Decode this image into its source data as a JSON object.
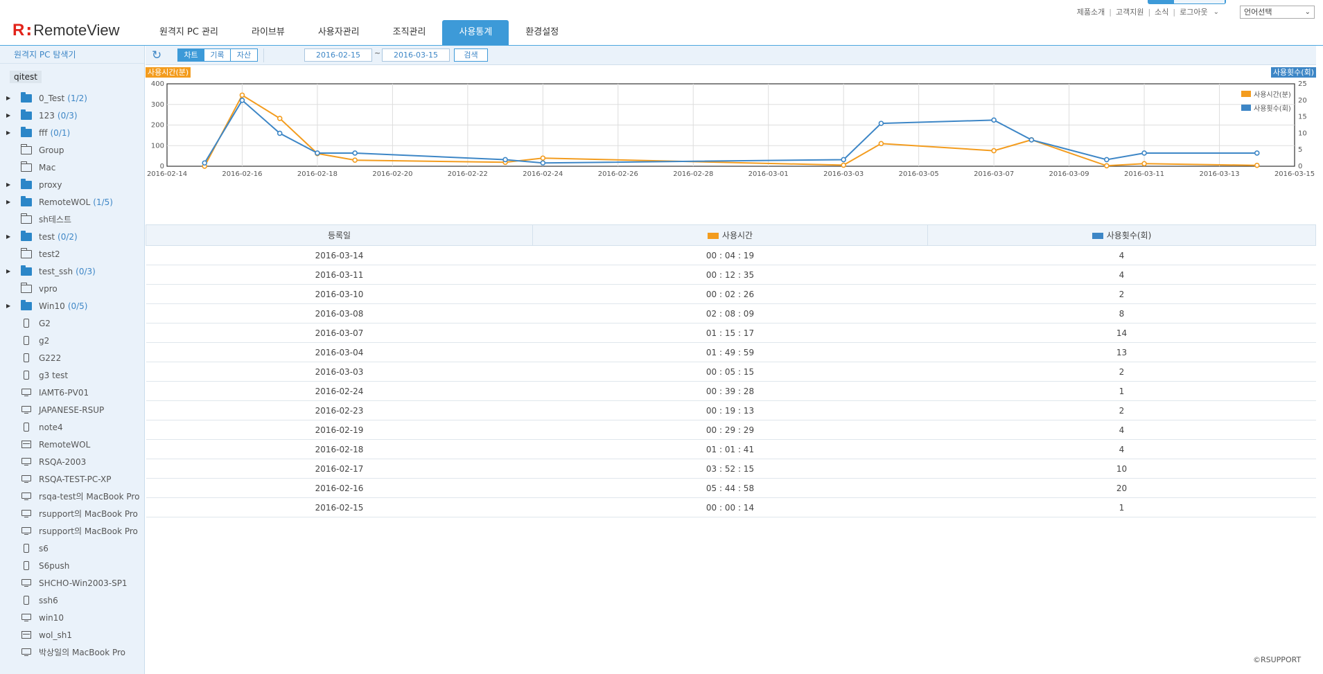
{
  "brand": {
    "logo_mark": "R",
    "name": "RemoteView"
  },
  "nav": {
    "tabs": [
      {
        "label": "원격지 PC 관리",
        "active": false
      },
      {
        "label": "라이브뷰",
        "active": false
      },
      {
        "label": "사용자관리",
        "active": false
      },
      {
        "label": "조직관리",
        "active": false
      },
      {
        "label": "사용통계",
        "active": true
      },
      {
        "label": "환경설정",
        "active": false
      }
    ]
  },
  "util": {
    "links": [
      "제품소개",
      "고객지원",
      "소식",
      "로그아웃"
    ],
    "language_select": "언어선택"
  },
  "sidebar": {
    "title": "원격지 PC 탐색기",
    "root": "qitest",
    "items": [
      {
        "label": "0_Test",
        "count": "(1/2)",
        "icon": "folder-filled-icon",
        "expandable": true
      },
      {
        "label": "123",
        "count": "(0/3)",
        "icon": "folder-filled-icon",
        "expandable": true
      },
      {
        "label": "fff",
        "count": "(0/1)",
        "icon": "folder-filled-icon",
        "expandable": true
      },
      {
        "label": "Group",
        "count": "",
        "icon": "folder-icon",
        "expandable": false
      },
      {
        "label": "Mac",
        "count": "",
        "icon": "folder-icon",
        "expandable": false
      },
      {
        "label": "proxy",
        "count": "",
        "icon": "folder-filled-icon",
        "expandable": true
      },
      {
        "label": "RemoteWOL",
        "count": "(1/5)",
        "icon": "folder-filled-icon",
        "expandable": true
      },
      {
        "label": "sh테스트",
        "count": "",
        "icon": "folder-icon",
        "expandable": false
      },
      {
        "label": "test",
        "count": "(0/2)",
        "icon": "folder-filled-icon",
        "expandable": true
      },
      {
        "label": "test2",
        "count": "",
        "icon": "folder-icon",
        "expandable": false
      },
      {
        "label": "test_ssh",
        "count": "(0/3)",
        "icon": "folder-filled-icon",
        "expandable": true
      },
      {
        "label": "vpro",
        "count": "",
        "icon": "folder-icon",
        "expandable": false
      },
      {
        "label": "Win10",
        "count": "(0/5)",
        "icon": "folder-filled-icon",
        "expandable": true
      },
      {
        "label": "G2",
        "count": "",
        "icon": "mobile-icon",
        "expandable": false
      },
      {
        "label": "g2",
        "count": "",
        "icon": "mobile-icon",
        "expandable": false
      },
      {
        "label": "G222",
        "count": "",
        "icon": "mobile-icon",
        "expandable": false
      },
      {
        "label": "g3 test",
        "count": "",
        "icon": "mobile-icon",
        "expandable": false
      },
      {
        "label": "IAMT6-PV01",
        "count": "",
        "icon": "monitor-icon",
        "expandable": false
      },
      {
        "label": "JAPANESE-RSUP",
        "count": "",
        "icon": "monitor-icon",
        "expandable": false
      },
      {
        "label": "note4",
        "count": "",
        "icon": "mobile-icon",
        "expandable": false
      },
      {
        "label": "RemoteWOL",
        "count": "",
        "icon": "server-icon",
        "expandable": false
      },
      {
        "label": "RSQA-2003",
        "count": "",
        "icon": "monitor-icon",
        "expandable": false
      },
      {
        "label": "RSQA-TEST-PC-XP",
        "count": "",
        "icon": "monitor-icon",
        "expandable": false
      },
      {
        "label": "rsqa-test의 MacBook Pro",
        "count": "",
        "icon": "monitor-icon",
        "expandable": false
      },
      {
        "label": "rsupport의 MacBook Pro",
        "count": "",
        "icon": "monitor-icon",
        "expandable": false
      },
      {
        "label": "rsupport의 MacBook Pro",
        "count": "",
        "icon": "monitor-icon",
        "expandable": false
      },
      {
        "label": "s6",
        "count": "",
        "icon": "mobile-icon",
        "expandable": false
      },
      {
        "label": "S6push",
        "count": "",
        "icon": "mobile-icon",
        "expandable": false
      },
      {
        "label": "SHCHO-Win2003-SP1",
        "count": "",
        "icon": "monitor-icon",
        "expandable": false
      },
      {
        "label": "ssh6",
        "count": "",
        "icon": "mobile-icon",
        "expandable": false
      },
      {
        "label": "win10",
        "count": "",
        "icon": "monitor-icon",
        "expandable": false
      },
      {
        "label": "wol_sh1",
        "count": "",
        "icon": "server-icon",
        "expandable": false
      },
      {
        "label": "박상일의 MacBook Pro",
        "count": "",
        "icon": "monitor-icon",
        "expandable": false
      }
    ]
  },
  "toolbar": {
    "refresh_icon": "refresh-icon",
    "views": [
      {
        "label": "차트",
        "active": true
      },
      {
        "label": "기록",
        "active": false
      },
      {
        "label": "자산",
        "active": false
      }
    ],
    "date_from": "2016-02-15",
    "tilde": "~",
    "date_to": "2016-03-15",
    "search_label": "검색"
  },
  "chart_data": {
    "type": "line",
    "left_axis_label": "사용시간(분)",
    "right_axis_label": "사용횟수(회)",
    "x_ticks": [
      "2016-02-14",
      "2016-02-16",
      "2016-02-18",
      "2016-02-20",
      "2016-02-22",
      "2016-02-24",
      "2016-02-26",
      "2016-02-28",
      "2016-03-01",
      "2016-03-03",
      "2016-03-05",
      "2016-03-07",
      "2016-03-09",
      "2016-03-11",
      "2016-03-13",
      "2016-03-15"
    ],
    "x": [
      "2016-02-15",
      "2016-02-16",
      "2016-02-17",
      "2016-02-18",
      "2016-02-19",
      "2016-02-23",
      "2016-02-24",
      "2016-03-03",
      "2016-03-04",
      "2016-03-07",
      "2016-03-08",
      "2016-03-10",
      "2016-03-11",
      "2016-03-14"
    ],
    "y_left_ticks": [
      0,
      100,
      200,
      300,
      400
    ],
    "y_left_range": [
      0,
      400
    ],
    "y_right_ticks": [
      0,
      5,
      10,
      15,
      20,
      25
    ],
    "y_right_range": [
      0,
      25
    ],
    "series": [
      {
        "name": "사용시간(분)",
        "axis": "left",
        "color": "#f39c1e",
        "values": [
          0.2,
          345,
          232.3,
          61.7,
          29.5,
          19.2,
          39.5,
          5.3,
          110,
          75.3,
          128.2,
          2.4,
          12.6,
          4.3
        ]
      },
      {
        "name": "사용횟수(회)",
        "axis": "right",
        "color": "#3d86c6",
        "values": [
          1,
          20,
          10,
          4,
          4,
          2,
          1,
          2,
          13,
          14,
          8,
          2,
          4,
          4
        ]
      }
    ],
    "legend_position": "top-right",
    "grid": true
  },
  "table": {
    "headers": {
      "date": "등록일",
      "time": "사용시간",
      "count": "사용횟수(회)"
    },
    "rows": [
      {
        "date": "2016-03-14",
        "time": "00 : 04 : 19",
        "count": "4"
      },
      {
        "date": "2016-03-11",
        "time": "00 : 12 : 35",
        "count": "4"
      },
      {
        "date": "2016-03-10",
        "time": "00 : 02 : 26",
        "count": "2"
      },
      {
        "date": "2016-03-08",
        "time": "02 : 08 : 09",
        "count": "8"
      },
      {
        "date": "2016-03-07",
        "time": "01 : 15 : 17",
        "count": "14"
      },
      {
        "date": "2016-03-04",
        "time": "01 : 49 : 59",
        "count": "13"
      },
      {
        "date": "2016-03-03",
        "time": "00 : 05 : 15",
        "count": "2"
      },
      {
        "date": "2016-02-24",
        "time": "00 : 39 : 28",
        "count": "1"
      },
      {
        "date": "2016-02-23",
        "time": "00 : 19 : 13",
        "count": "2"
      },
      {
        "date": "2016-02-19",
        "time": "00 : 29 : 29",
        "count": "4"
      },
      {
        "date": "2016-02-18",
        "time": "01 : 01 : 41",
        "count": "4"
      },
      {
        "date": "2016-02-17",
        "time": "03 : 52 : 15",
        "count": "10"
      },
      {
        "date": "2016-02-16",
        "time": "05 : 44 : 58",
        "count": "20"
      },
      {
        "date": "2016-02-15",
        "time": "00 : 00 : 14",
        "count": "1"
      }
    ]
  },
  "footer": {
    "copyright": "©RSUPPORT"
  }
}
